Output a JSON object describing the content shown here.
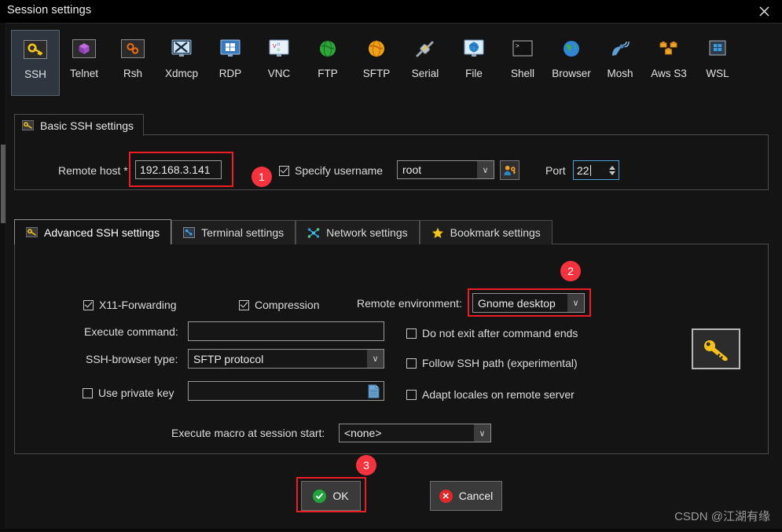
{
  "window": {
    "title": "Session settings",
    "close_icon": "close-icon"
  },
  "protocols": [
    {
      "label": "SSH",
      "icon": "key-icon",
      "selected": true
    },
    {
      "label": "Telnet",
      "icon": "purple-cube-icon",
      "selected": false
    },
    {
      "label": "Rsh",
      "icon": "orange-gears-icon",
      "selected": false
    },
    {
      "label": "Xdmcp",
      "icon": "x-monitor-icon",
      "selected": false
    },
    {
      "label": "RDP",
      "icon": "windows-monitor-icon",
      "selected": false
    },
    {
      "label": "VNC",
      "icon": "vnc-monitor-icon",
      "selected": false
    },
    {
      "label": "FTP",
      "icon": "green-globe-icon",
      "selected": false
    },
    {
      "label": "SFTP",
      "icon": "orange-globe-icon",
      "selected": false
    },
    {
      "label": "Serial",
      "icon": "serial-plug-icon",
      "selected": false
    },
    {
      "label": "File",
      "icon": "file-monitor-icon",
      "selected": false
    },
    {
      "label": "Shell",
      "icon": "terminal-icon",
      "selected": false
    },
    {
      "label": "Browser",
      "icon": "blue-globe-icon",
      "selected": false
    },
    {
      "label": "Mosh",
      "icon": "satellite-dish-icon",
      "selected": false
    },
    {
      "label": "Aws S3",
      "icon": "aws-cubes-icon",
      "selected": false
    },
    {
      "label": "WSL",
      "icon": "windows-icon",
      "selected": false
    }
  ],
  "basic": {
    "legend": "Basic SSH settings",
    "legend_icon": "key-icon",
    "remote_host_label": "Remote host *",
    "remote_host_value": "192.168.3.141",
    "specify_username_label": "Specify username",
    "specify_username_checked": true,
    "username_value": "root",
    "user_key_button_icon": "user-key-icon",
    "port_label": "Port",
    "port_value": "22"
  },
  "tabs": [
    {
      "label": "Advanced SSH settings",
      "icon": "key-icon",
      "active": true
    },
    {
      "label": "Terminal settings",
      "icon": "terminal-blue-icon",
      "active": false
    },
    {
      "label": "Network settings",
      "icon": "network-icon",
      "active": false
    },
    {
      "label": "Bookmark settings",
      "icon": "star-icon",
      "active": false
    }
  ],
  "advanced": {
    "x11_label": "X11-Forwarding",
    "x11_checked": true,
    "compression_label": "Compression",
    "compression_checked": true,
    "remote_env_label": "Remote environment:",
    "remote_env_value": "Gnome desktop",
    "execute_command_label": "Execute command:",
    "execute_command_value": "",
    "ssh_browser_label": "SSH-browser type:",
    "ssh_browser_value": "SFTP protocol",
    "use_private_key_label": "Use private key",
    "use_private_key_checked": false,
    "private_key_value": "",
    "private_key_browse_icon": "file-page-icon",
    "do_not_exit_label": "Do not exit after command ends",
    "do_not_exit_checked": false,
    "follow_ssh_path_label": "Follow SSH path (experimental)",
    "follow_ssh_path_checked": false,
    "adapt_locales_label": "Adapt locales on remote server",
    "adapt_locales_checked": false,
    "macro_label": "Execute macro at session start:",
    "macro_value": "<none>",
    "side_key_icon": "key-icon"
  },
  "buttons": {
    "ok_label": "OK",
    "ok_icon": "green-check-icon",
    "cancel_label": "Cancel",
    "cancel_icon": "red-x-icon"
  },
  "annotations": {
    "badge1": "1",
    "badge2": "2",
    "badge3": "3",
    "highlight_color": "#ee1c25",
    "badge_color": "#f5333f"
  },
  "watermark": "CSDN @江湖有缘"
}
